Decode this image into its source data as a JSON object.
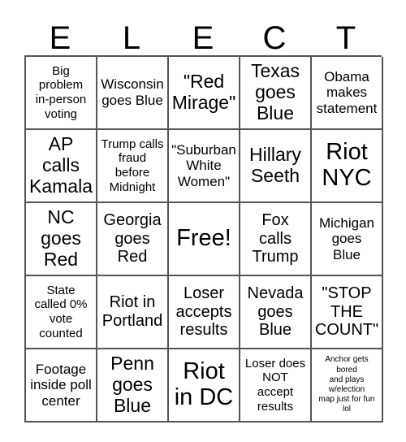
{
  "card": {
    "header_letters": [
      "E",
      "L",
      "E",
      "C",
      "T"
    ],
    "rows": [
      [
        {
          "text": "Big\nproblem\nin-person\nvoting",
          "size": "sm",
          "free": false
        },
        {
          "text": "Wisconsin\ngoes Blue",
          "size": "md",
          "free": false
        },
        {
          "text": "\"Red\nMirage\"",
          "size": "xl",
          "free": false
        },
        {
          "text": "Texas\ngoes\nBlue",
          "size": "xl",
          "free": false
        },
        {
          "text": "Obama\nmakes\nstatement",
          "size": "md",
          "free": false
        }
      ],
      [
        {
          "text": "AP\ncalls\nKamala",
          "size": "xl",
          "free": false
        },
        {
          "text": "Trump calls\nfraud\nbefore\nMidnight",
          "size": "sm",
          "free": false
        },
        {
          "text": "\"Suburban\nWhite\nWomen\"",
          "size": "md",
          "free": false
        },
        {
          "text": "Hillary\nSeeth",
          "size": "xl",
          "free": false
        },
        {
          "text": "Riot\nNYC",
          "size": "xxl",
          "free": false
        }
      ],
      [
        {
          "text": "NC\ngoes\nRed",
          "size": "xl",
          "free": false
        },
        {
          "text": "Georgia\ngoes\nRed",
          "size": "lg",
          "free": false
        },
        {
          "text": "Free!",
          "size": "xxl",
          "free": true
        },
        {
          "text": "Fox\ncalls\nTrump",
          "size": "lg",
          "free": false
        },
        {
          "text": "Michigan\ngoes\nBlue",
          "size": "md",
          "free": false
        }
      ],
      [
        {
          "text": "State\ncalled 0%\nvote\ncounted",
          "size": "sm",
          "free": false
        },
        {
          "text": "Riot in\nPortland",
          "size": "lg",
          "free": false
        },
        {
          "text": "Loser\naccepts\nresults",
          "size": "lg",
          "free": false
        },
        {
          "text": "Nevada\ngoes\nBlue",
          "size": "lg",
          "free": false
        },
        {
          "text": "\"STOP\nTHE\nCOUNT\"",
          "size": "lg",
          "free": false
        }
      ],
      [
        {
          "text": "Footage\ninside poll\ncenter",
          "size": "md",
          "free": false
        },
        {
          "text": "Penn\ngoes\nBlue",
          "size": "xl",
          "free": false
        },
        {
          "text": "Riot\nin DC",
          "size": "xxl",
          "free": false
        },
        {
          "text": "Loser does\nNOT\naccept\nresults",
          "size": "sm",
          "free": false
        },
        {
          "text": "Anchor gets\nbored\nand plays\nw/election\nmap just for fun\nlol",
          "size": "xxs",
          "free": false
        }
      ]
    ],
    "colors": {
      "background": "#ffffff",
      "text": "#000000",
      "grid_line": "#555555"
    }
  }
}
